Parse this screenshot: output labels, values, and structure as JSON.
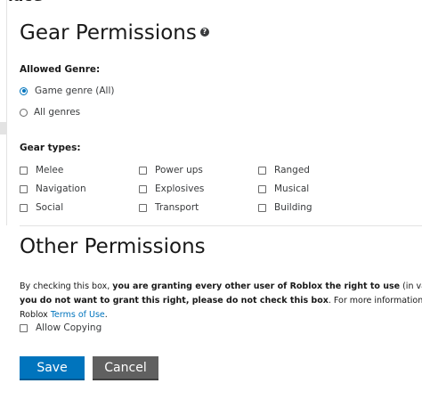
{
  "top_heading": "lace",
  "gear": {
    "title": "Gear Permissions",
    "help_glyph": "?",
    "allowed_genre_label": "Allowed Genre:",
    "genre_options": [
      {
        "label": "Game genre (All)",
        "selected": true
      },
      {
        "label": "All genres",
        "selected": false
      }
    ],
    "gear_types_label": "Gear types:",
    "gear_types": [
      {
        "label": "Melee",
        "checked": false
      },
      {
        "label": "Power ups",
        "checked": false
      },
      {
        "label": "Ranged",
        "checked": false
      },
      {
        "label": "Navigation",
        "checked": false
      },
      {
        "label": "Explosives",
        "checked": false
      },
      {
        "label": "Musical",
        "checked": false
      },
      {
        "label": "Social",
        "checked": false
      },
      {
        "label": "Transport",
        "checked": false
      },
      {
        "label": "Building",
        "checked": false
      }
    ]
  },
  "other": {
    "title": "Other Permissions",
    "para_line1_normal": "By checking this box, ",
    "para_line1_bold": "you are granting every other user of Roblox the right to use",
    "para_line1_tail": " (in various wa",
    "para_line2_bold": "you do not want to grant this right, please do not check this box",
    "para_line2_tail": ". For more information about s",
    "para_line3_normal": "Roblox ",
    "terms_link": "Terms of Use",
    "para_line3_end": ".",
    "allow_copying_label": "Allow Copying",
    "allow_copying_checked": false
  },
  "buttons": {
    "save": "Save",
    "cancel": "Cancel"
  },
  "colors": {
    "primary": "#0074bd",
    "cancel": "#606060",
    "link": "#0074bd"
  }
}
